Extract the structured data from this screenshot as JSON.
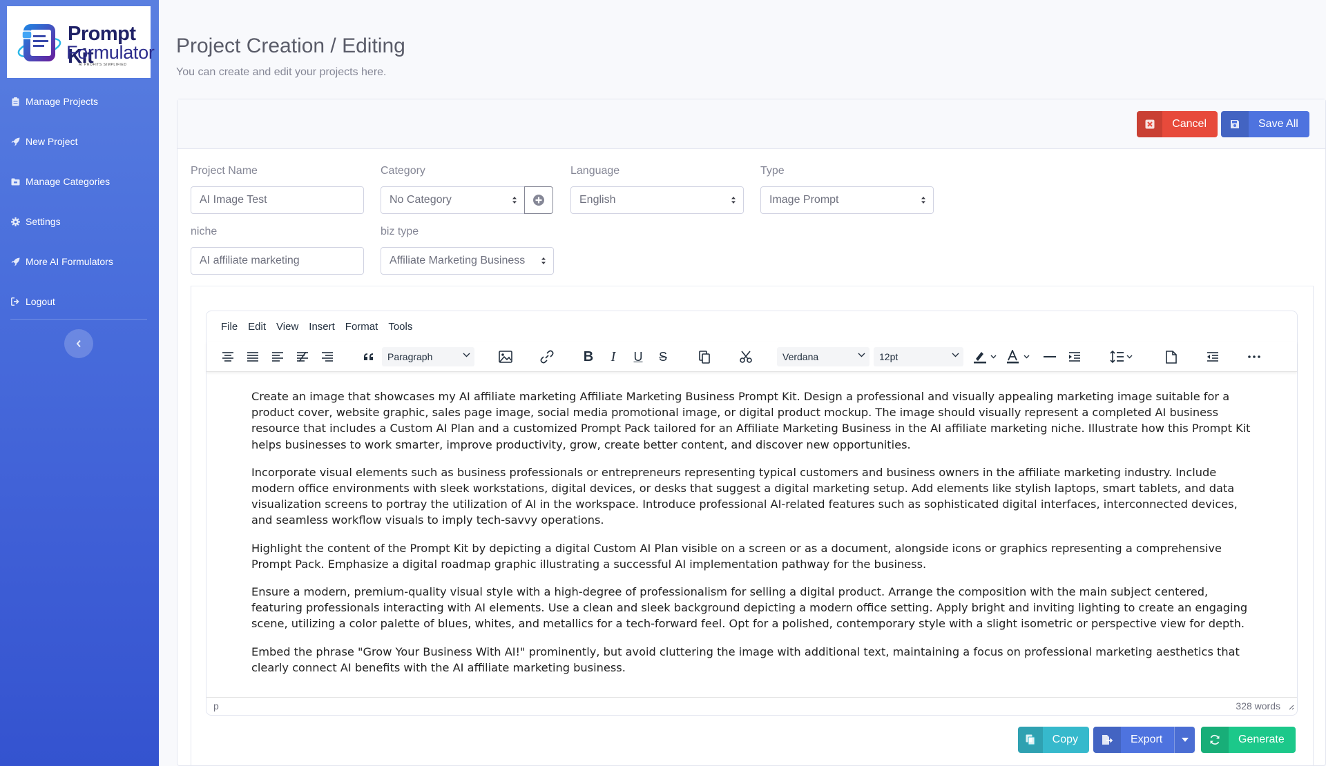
{
  "app": {
    "logo_line1": "Prompt Kit",
    "logo_line2": "Formulator",
    "logo_tagline": "AI PROFITS SIMPLIFIED"
  },
  "sidebar": {
    "items": [
      {
        "label": "Manage Projects",
        "icon": "clipboard-icon"
      },
      {
        "label": "New Project",
        "icon": "rocket-icon"
      },
      {
        "label": "Manage Categories",
        "icon": "folder-icon"
      },
      {
        "label": "Settings",
        "icon": "gear-icon"
      },
      {
        "label": "More AI Formulators",
        "icon": "rocket-icon"
      },
      {
        "label": "Logout",
        "icon": "sign-out-icon"
      }
    ],
    "toggle_icon": "chevron-left-icon"
  },
  "header": {
    "title": "Project Creation / Editing",
    "subtitle": "You can create and edit your projects here."
  },
  "actions": {
    "cancel_label": "Cancel",
    "save_label": "Save All",
    "copy_label": "Copy",
    "export_label": "Export",
    "generate_label": "Generate"
  },
  "form": {
    "project_name": {
      "label": "Project Name",
      "value": "AI Image Test"
    },
    "category": {
      "label": "Category",
      "value": "No Category"
    },
    "language": {
      "label": "Language",
      "value": "English"
    },
    "type": {
      "label": "Type",
      "value": "Image Prompt"
    },
    "niche": {
      "label": "niche",
      "value": "AI affiliate marketing"
    },
    "biz_type": {
      "label": "biz type",
      "value": "Affiliate Marketing Business"
    }
  },
  "editor": {
    "menu": [
      "File",
      "Edit",
      "View",
      "Insert",
      "Format",
      "Tools"
    ],
    "block_format": "Paragraph",
    "font_family": "Verdana",
    "font_size": "12pt",
    "paragraphs": [
      "Create an image that showcases my AI affiliate marketing Affiliate Marketing Business Prompt Kit. Design a professional and visually appealing marketing image suitable for a product cover, website graphic, sales page image, social media promotional image, or digital product mockup. The image should visually represent a completed AI business resource that includes a Custom AI Plan and a customized Prompt Pack tailored for an Affiliate Marketing Business in the AI affiliate marketing niche. Illustrate how this Prompt Kit helps businesses to work smarter, improve productivity, grow, create better content, and discover new opportunities.",
      "Incorporate visual elements such as business professionals or entrepreneurs representing typical customers and business owners in the affiliate marketing industry. Include modern office environments with sleek workstations, digital devices, or desks that suggest a digital marketing setup. Add elements like stylish laptops, smart tablets, and data visualization screens to portray the utilization of AI in the workspace. Introduce professional AI-related features such as sophisticated digital interfaces, interconnected devices, and seamless workflow visuals to imply tech-savvy operations.",
      "Highlight the content of the Prompt Kit by depicting a digital Custom AI Plan visible on a screen or as a document, alongside icons or graphics representing a comprehensive Prompt Pack. Emphasize a digital roadmap graphic illustrating a successful AI implementation pathway for the business.",
      "Ensure a modern, premium-quality visual style with a high-degree of professionalism for selling a digital product. Arrange the composition with the main subject centered, featuring professionals interacting with AI elements. Use a clean and sleek background depicting a modern office setting. Apply bright and inviting lighting to create an engaging scene, utilizing a color palette of blues, whites, and metallics for a tech-forward feel. Opt for a polished, contemporary style with a slight isometric or perspective view for depth.",
      "Embed the phrase \"Grow Your Business With AI!\" prominently, but avoid cluttering the image with additional text, maintaining a focus on professional marketing aesthetics that clearly connect AI benefits with the AI affiliate marketing business."
    ],
    "status_path": "p",
    "word_count": "328 words"
  },
  "colors": {
    "sidebar": "#4e73df",
    "danger": "#e74a3b",
    "primary": "#4e73df",
    "info": "#36b9cc",
    "success": "#1cc88a"
  }
}
